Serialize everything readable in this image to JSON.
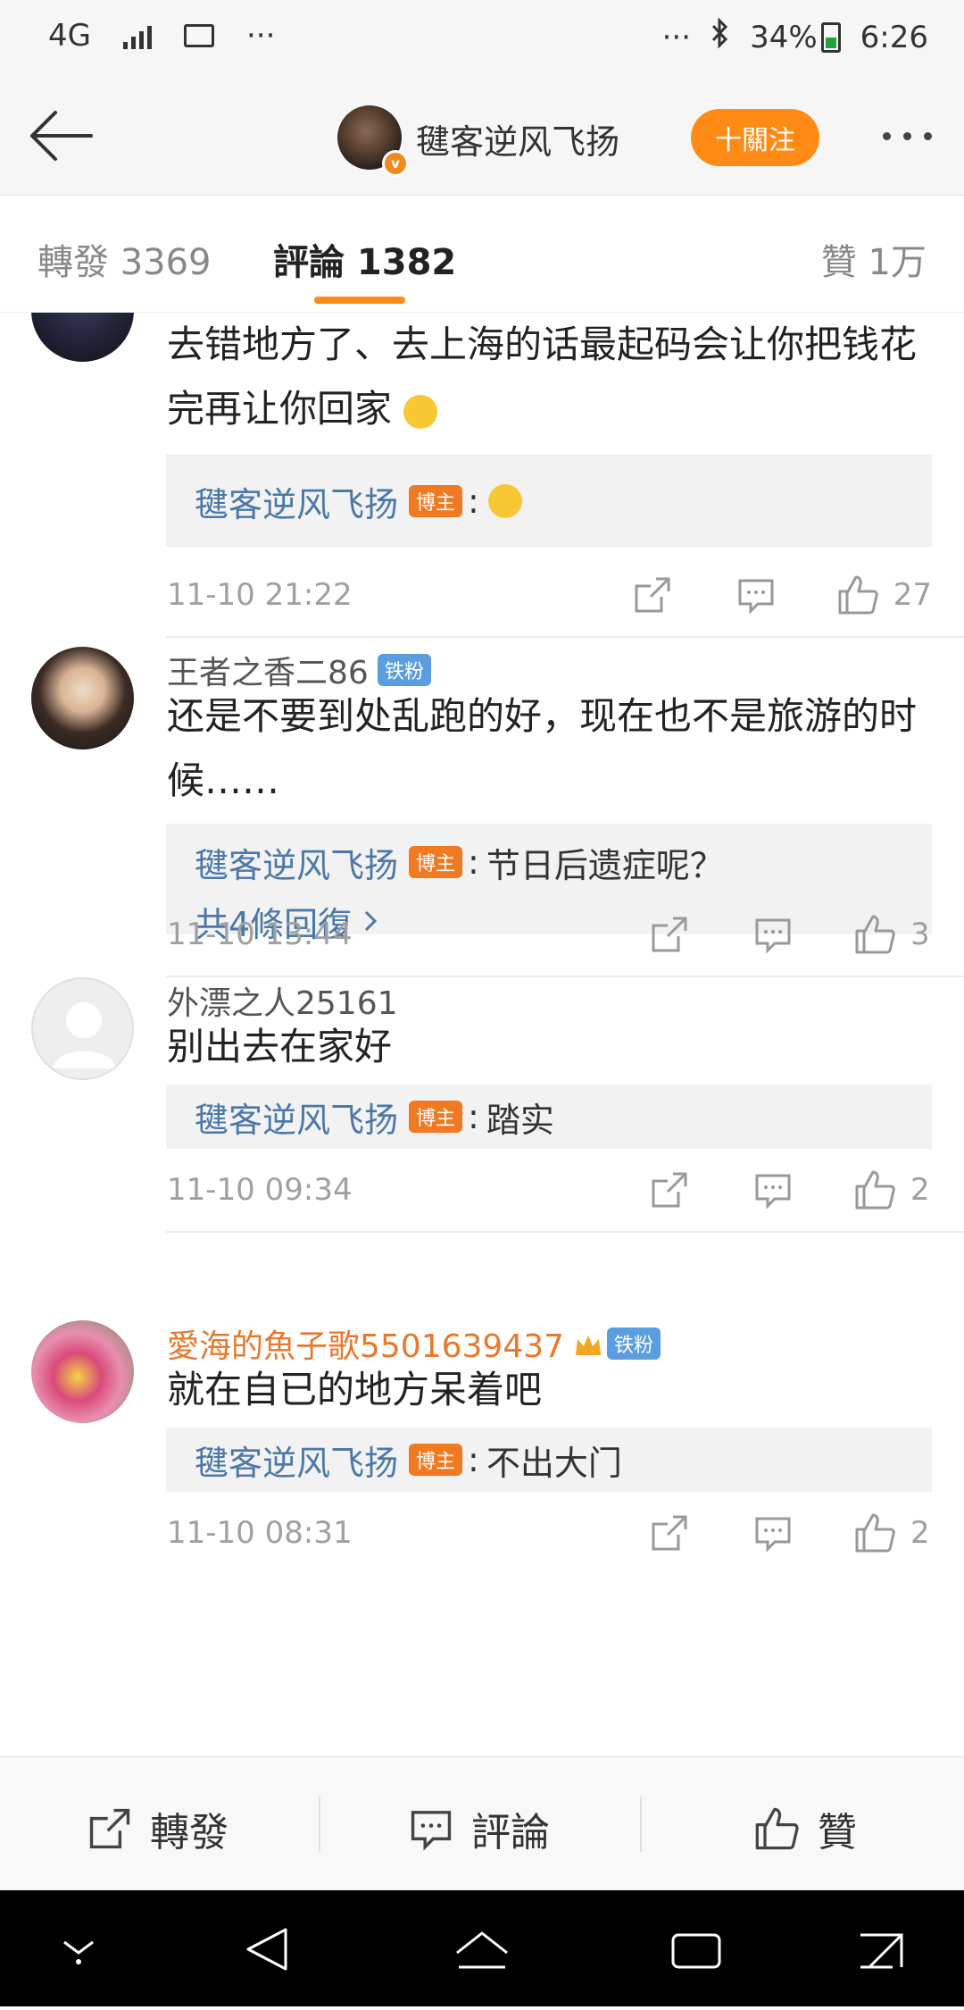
{
  "status_bar": {
    "network": "4G",
    "overflow": "···",
    "overflow_right": "···",
    "battery": "34%",
    "time": "6:26"
  },
  "header": {
    "title": "毽客逆风飞扬",
    "verified_mark": "v",
    "follow_label": "十關注"
  },
  "tabs": {
    "repost": "轉發 3369",
    "comment": "評論 1382",
    "like": "贊 1万"
  },
  "comments": [
    {
      "username": "",
      "text": "去错地方了、去上海的话最起码会让你把钱花完再让你回家",
      "text_emoji": "thinking-face",
      "reply": {
        "author": "毽客逆风飞扬",
        "badge": "博主",
        "sep": ":",
        "text": "",
        "emoji": "laughing-face"
      },
      "time": "11-10 21:22",
      "likes": "27"
    },
    {
      "username": "王者之香二86",
      "fan_badge": "铁粉",
      "text": "还是不要到处乱跑的好，现在也不是旅游的时候……",
      "reply": {
        "author": "毽客逆风飞扬",
        "badge": "博主",
        "sep": ":",
        "text": "节日后遗症呢？"
      },
      "more_replies": "共4條回復",
      "time": "11-10 13:44",
      "likes": "3"
    },
    {
      "username": "外漂之人25161",
      "text": "别出去在家好",
      "reply": {
        "author": "毽客逆风飞扬",
        "badge": "博主",
        "sep": ":",
        "text": "踏实"
      },
      "time": "11-10 09:34",
      "likes": "2"
    },
    {
      "username": "愛海的魚子歌5501639437",
      "fan_badge": "铁粉",
      "text": "就在自已的地方呆着吧",
      "reply": {
        "author": "毽客逆风飞扬",
        "badge": "博主",
        "sep": ":",
        "text": "不出大门"
      },
      "time": "11-10 08:31",
      "likes": "2"
    }
  ],
  "bottom_bar": {
    "repost": "轉發",
    "comment": "評論",
    "like": "贊"
  },
  "colors": {
    "accent": "#ff8a15",
    "link": "#4c78a8",
    "bozhu_badge": "#f07a22",
    "fan_badge": "#5a9ee0",
    "vip_name": "#e8782c"
  }
}
